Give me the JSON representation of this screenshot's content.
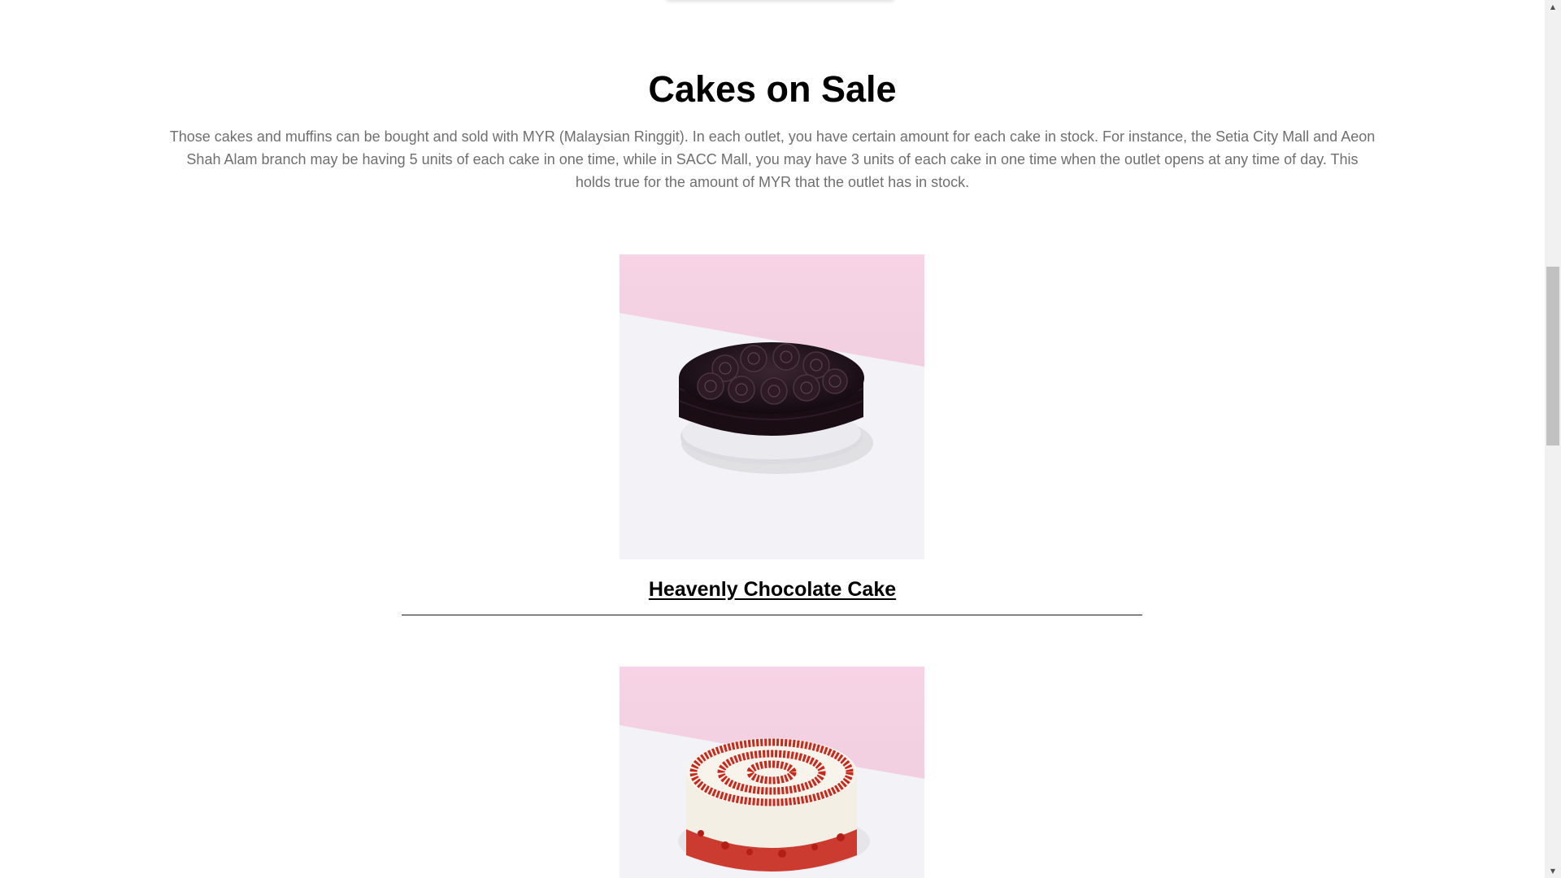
{
  "section": {
    "title": "Cakes on Sale",
    "description": "Those cakes and muffins can be bought and sold with MYR (Malaysian Ringgit). In each outlet, you have certain amount for each cake in stock. For instance, the Setia City Mall and Aeon Shah Alam branch may be having 5 units of each cake in one time, while in SACC Mall, you may have 3 units of each cake in one time when the outlet opens at any time of day. This holds true for the amount of MYR that the outlet has in stock."
  },
  "cakes": [
    {
      "name": "Heavenly Chocolate Cake"
    }
  ],
  "scrollbar": {
    "up_icon": "triangle-up",
    "down_icon": "triangle-down",
    "up_glyph": "▲",
    "down_glyph": "▼"
  },
  "colors": {
    "background": "#ffffff",
    "title": "#000000",
    "description": "#6f6f6f",
    "photo_pink": "#f5d6e6",
    "photo_white": "#f3f3f5"
  }
}
